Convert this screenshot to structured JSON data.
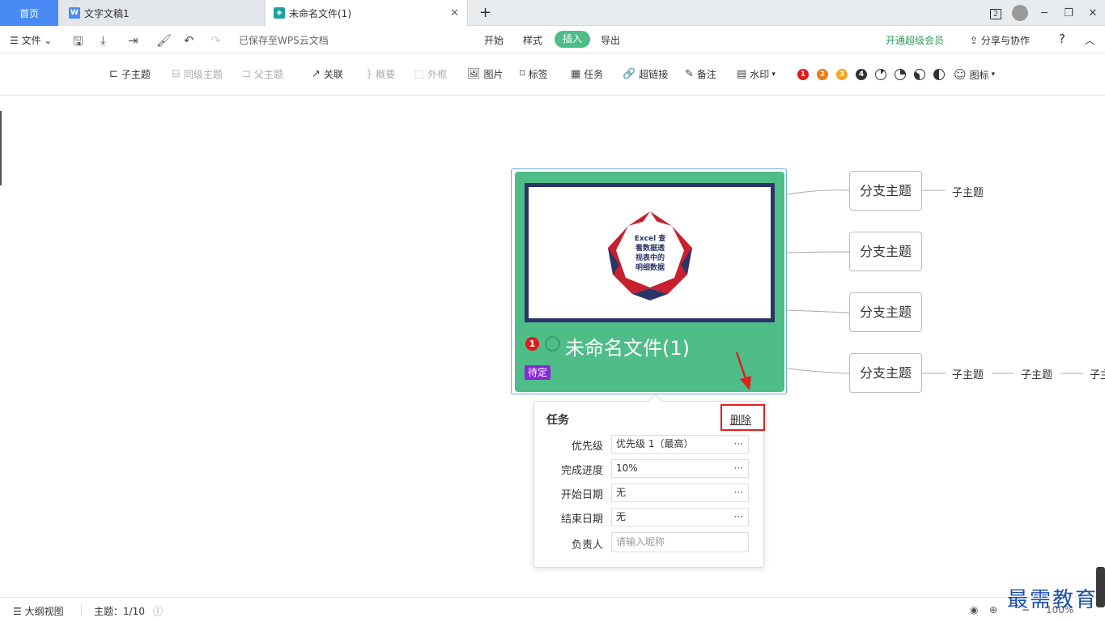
{
  "tabs": {
    "home": "首页",
    "doc": "文字文稿1",
    "mind": "未命名文件(1)"
  },
  "titlebar": {
    "badge": "2"
  },
  "menubar": {
    "file": "文件",
    "saved": "已保存至WPS云文档",
    "start": "开始",
    "style": "样式",
    "insert": "插入",
    "export": "导出",
    "vip": "开通超级会员",
    "share": "分享与协作",
    "help": "?"
  },
  "toolbar": {
    "child": "子主题",
    "sibling": "同级主题",
    "parent": "父主题",
    "link": "关联",
    "summary": "概要",
    "frame": "外框",
    "image": "图片",
    "label": "标签",
    "task": "任务",
    "hyperlink": "超链接",
    "note": "备注",
    "watermark": "水印",
    "icons": "图标",
    "priorities": [
      "1",
      "2",
      "3",
      "4"
    ],
    "priority_colors": [
      "#e5191b",
      "#f07a16",
      "#f5a623",
      "#333333"
    ]
  },
  "root": {
    "title": "未命名文件(1)",
    "badge": "1",
    "tag": "待定",
    "image_text": "Excel 查看数据透视表中的明细数据",
    "image_lines": [
      "Excel 查",
      "看数据透",
      "视表中的",
      "明细数据"
    ],
    "color": "#4ebd87"
  },
  "branches": [
    "分支主题",
    "分支主题",
    "分支主题",
    "分支主题"
  ],
  "subtopics": {
    "b1": "子主题",
    "b4": [
      "子主题",
      "子主题",
      "子主"
    ]
  },
  "panel": {
    "title": "任务",
    "delete": "删除",
    "fields": [
      {
        "label": "优先级",
        "value": "优先级 1（最高）",
        "dots": "···"
      },
      {
        "label": "完成进度",
        "value": "10%",
        "dots": "···"
      },
      {
        "label": "开始日期",
        "value": "无",
        "dots": "···"
      },
      {
        "label": "结束日期",
        "value": "无",
        "dots": "···"
      },
      {
        "label": "负责人",
        "placeholder": "请输入昵称"
      }
    ]
  },
  "status": {
    "outline": "大纲视图",
    "topics": "主题：1/10",
    "zoom": "100%"
  },
  "watermark": "最需教育"
}
